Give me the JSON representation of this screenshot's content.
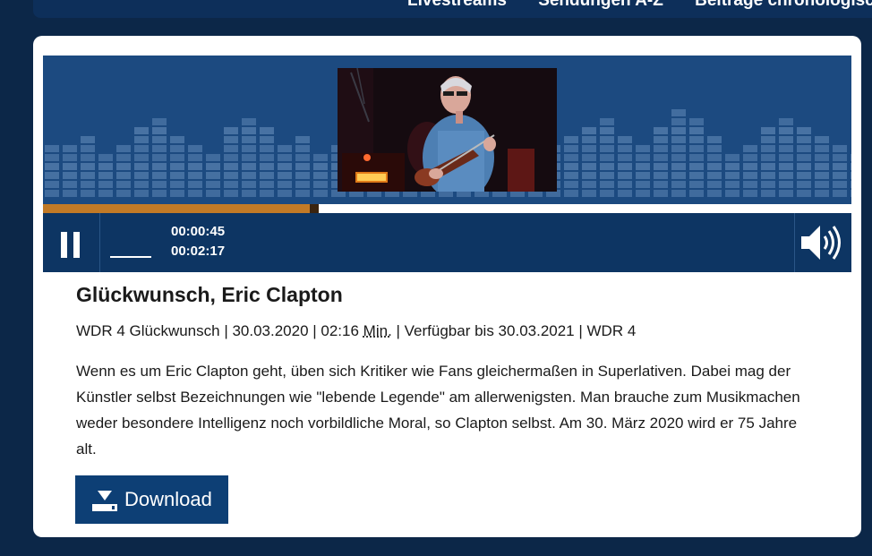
{
  "nav": {
    "items": [
      "Livestreams",
      "Sendungen A-Z",
      "Beiträge chronologisch"
    ]
  },
  "player": {
    "elapsed": "00:00:45",
    "duration": "00:02:17",
    "progress_fraction": 0.33,
    "playing": true,
    "thumbnail_subject": "Eric Clapton playing guitar on stage",
    "colors": {
      "progress": "#c27a26",
      "controls": "#0d3563",
      "visualizer_bg": "#1c4a80"
    }
  },
  "episode": {
    "title": "Glückwunsch, Eric Clapton",
    "meta_prefix": "WDR 4 Glückwunsch | 30.03.2020 | 02:16 ",
    "meta_unit": "Min.",
    "meta_suffix": " | Verfügbar bis 30.03.2021 | WDR 4",
    "description": "Wenn es um Eric Clapton geht, üben sich Kritiker wie Fans gleichermaßen in Superlativen. Dabei mag der Künstler selbst Bezeichnungen wie \"lebende Legende\" am allerwenigsten. Man brauche zum Musikmachen weder besondere Intelligenz noch vorbildliche Moral, so Clapton selbst. Am 30. März 2020 wird er 75 Jahre alt."
  },
  "download": {
    "label": "Download"
  },
  "icons": {
    "pause": "pause-icon",
    "volume": "volume-icon",
    "download": "download-icon"
  }
}
